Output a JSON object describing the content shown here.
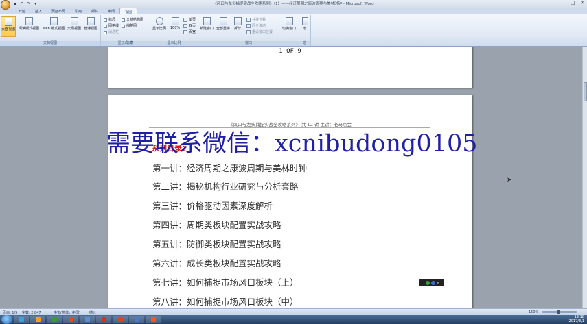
{
  "window": {
    "title": "《风口与龙头捕捉实战全攻略系列》（1）——经济周期之康波周期与美林时钟 - Microsoft Word",
    "controls": [
      "–",
      "□",
      "✕"
    ]
  },
  "ribbon_tabs": [
    "开始",
    "插入",
    "页面布局",
    "引用",
    "邮件",
    "审阅",
    "视图"
  ],
  "ribbon": {
    "views": [
      "页面视图",
      "阅读版式视图",
      "Web 版式视图",
      "大纲视图",
      "普通视图"
    ],
    "views_group": "文档视图",
    "show_hide": [
      "标尺",
      "网格线",
      "消息栏",
      "文档结构图",
      "缩略图"
    ],
    "show_hide_group": "显示/隐藏",
    "zoom": [
      "显示比例",
      "100%",
      "单页",
      "双页",
      "页宽"
    ],
    "zoom_group": "显示比例",
    "window": [
      "新建窗口",
      "全部重排",
      "拆分",
      "并排查看",
      "同步滚动",
      "重设窗口位置",
      "切换窗口"
    ],
    "window_group": "窗口",
    "macro": [
      "宏"
    ],
    "macro_group": "宏"
  },
  "document": {
    "page1_footer": "1 OF 9",
    "header": "《风口与龙头捕捉实战全攻略系列》  共 12 讲    主讲：老马点金",
    "series_title": "系列目录：",
    "lectures": [
      "第一讲：经济周期之康波周期与美林时钟",
      "第二讲：揭秘机构行业研究与分析套路",
      "第三讲：价格驱动因素深度解析",
      "第四讲：周期类板块配置实战攻略",
      "第五讲：防御类板块配置实战攻略",
      "第六讲：成长类板块配置实战攻略",
      "第七讲：如何捕捉市场风口板块（上）",
      "第八讲：如何捕捉市场风口板块（中）"
    ],
    "watermark": "需要联系微信：xcnibudong0105"
  },
  "statusbar": {
    "page": "页面: 1/9",
    "words": "字数: 2,847",
    "language": "中文(简体，中国)",
    "mode": "插入",
    "zoom": "150%"
  },
  "taskbar": {
    "time": "19:18",
    "date": "2017/3/1",
    "app_colors": [
      "#3aa0e0",
      "#f3a21b",
      "#3c9a3c",
      "#e04a2a",
      "#5a8fd6",
      "#c63a2a",
      "#d9452b",
      "#4c7ac9",
      "#e65c2a"
    ]
  },
  "colors": {
    "accent_red": "#d42020",
    "watermark_blue": "#1f1fa8"
  }
}
